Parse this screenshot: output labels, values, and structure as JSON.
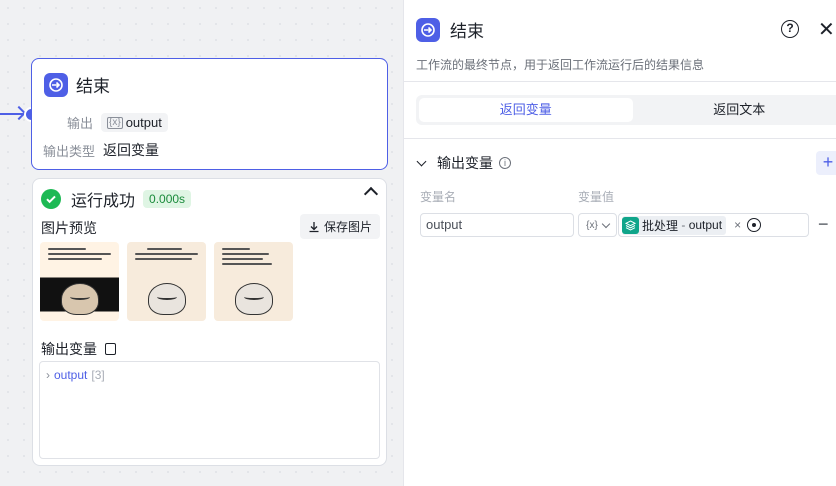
{
  "node": {
    "title": "结束",
    "output_label": "输出",
    "output_var": "output",
    "output_type_label": "输出类型",
    "output_type_value": "返回变量"
  },
  "run": {
    "status": "运行成功",
    "time": "0.000s",
    "preview_label": "图片预览",
    "save_label": "保存图片",
    "output_vars_label": "输出变量",
    "tree_key": "output",
    "tree_count": "[3]"
  },
  "panel": {
    "title": "结束",
    "description": "工作流的最终节点，用于返回工作流运行后的结果信息",
    "tabs": [
      "返回变量",
      "返回文本"
    ],
    "section_title": "输出变量",
    "col_name": "变量名",
    "col_value": "变量值",
    "var_name": "output",
    "ref_source": "批处理",
    "ref_sep": " - ",
    "ref_var": "output"
  },
  "colors": {
    "accent": "#4e5fe6",
    "success": "#1db954",
    "batch": "#10a58a"
  }
}
